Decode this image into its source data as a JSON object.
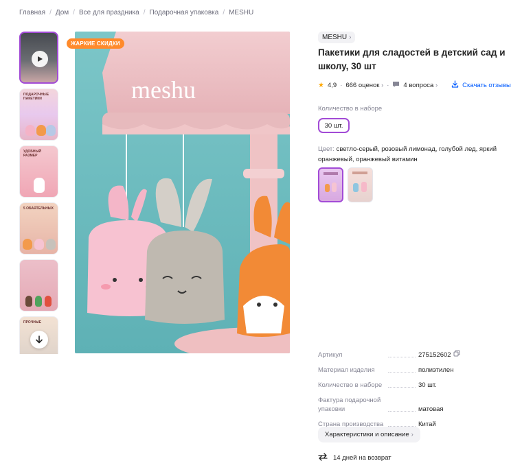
{
  "breadcrumb": [
    "Главная",
    "Дом",
    "Все для праздника",
    "Подарочная упаковка",
    "MESHU"
  ],
  "thumbnails": [
    {
      "icon": "play-icon",
      "label": ""
    },
    {
      "icon": "",
      "label": "ПОДАРОЧНЫЕ ПАКЕТИКИ"
    },
    {
      "icon": "",
      "label": "УДОБНЫЙ РАЗМЕР"
    },
    {
      "icon": "",
      "label": "5 ОБАЯТЕЛЬНЫХ"
    },
    {
      "icon": "",
      "label": ""
    },
    {
      "icon": "arrow-down-icon",
      "label": "ПРОЧНЫЕ"
    }
  ],
  "promo_badge": "ЖАРКИЕ СКИДКИ",
  "image": {
    "brand_text": "meshu"
  },
  "product": {
    "brand": "MESHU",
    "title": "Пакетики для сладостей в детский сад и школу, 30 шт",
    "rating": "4,9",
    "reviews": "666 оценок",
    "questions": "4 вопроса",
    "download_reviews": "Скачать отзывы"
  },
  "quantity": {
    "label": "Количество в наборе",
    "selected": "30 шт."
  },
  "color": {
    "label": "Цвет:",
    "value": "светло-серый, розовый лимонад, голубой лед, яркий оранжевый, оранжевый витамин"
  },
  "specs": [
    {
      "key": "Артикул",
      "value": "275152602"
    },
    {
      "key": "Материал изделия",
      "value": "полиэтилен"
    },
    {
      "key": "Количество в наборе",
      "value": "30 шт."
    },
    {
      "key": "Фактура подарочной упаковки",
      "value": "матовая"
    },
    {
      "key": "Страна производства",
      "value": "Китай"
    }
  ],
  "characteristics_button": "Характеристики и описание",
  "return_policy": "14 дней на возврат",
  "colors": {
    "accent": "#a24bd6",
    "badge": "#ff8a2b",
    "link": "#005bff",
    "star": "#ffa800"
  }
}
